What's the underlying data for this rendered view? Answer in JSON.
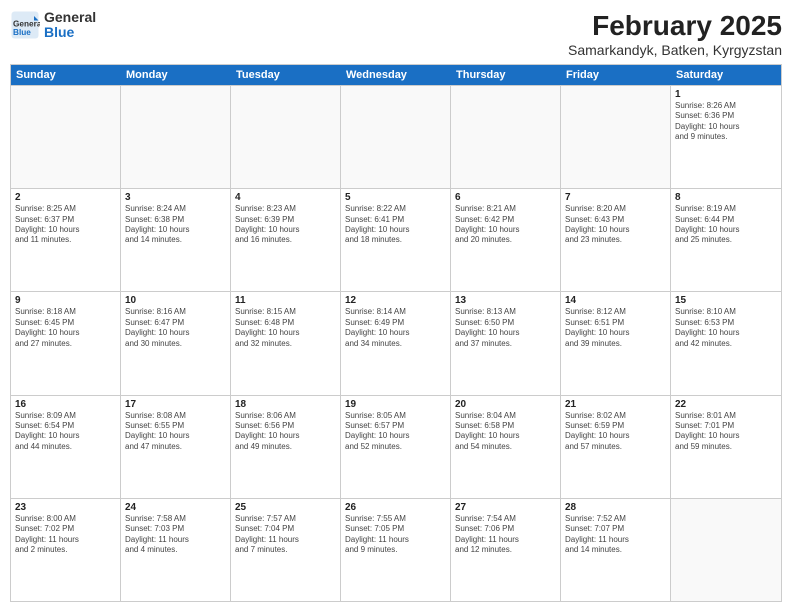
{
  "logo": {
    "general": "General",
    "blue": "Blue"
  },
  "title": "February 2025",
  "location": "Samarkandyk, Batken, Kyrgyzstan",
  "header_days": [
    "Sunday",
    "Monday",
    "Tuesday",
    "Wednesday",
    "Thursday",
    "Friday",
    "Saturday"
  ],
  "weeks": [
    [
      {
        "day": "",
        "info": ""
      },
      {
        "day": "",
        "info": ""
      },
      {
        "day": "",
        "info": ""
      },
      {
        "day": "",
        "info": ""
      },
      {
        "day": "",
        "info": ""
      },
      {
        "day": "",
        "info": ""
      },
      {
        "day": "1",
        "info": "Sunrise: 8:26 AM\nSunset: 6:36 PM\nDaylight: 10 hours\nand 9 minutes."
      }
    ],
    [
      {
        "day": "2",
        "info": "Sunrise: 8:25 AM\nSunset: 6:37 PM\nDaylight: 10 hours\nand 11 minutes."
      },
      {
        "day": "3",
        "info": "Sunrise: 8:24 AM\nSunset: 6:38 PM\nDaylight: 10 hours\nand 14 minutes."
      },
      {
        "day": "4",
        "info": "Sunrise: 8:23 AM\nSunset: 6:39 PM\nDaylight: 10 hours\nand 16 minutes."
      },
      {
        "day": "5",
        "info": "Sunrise: 8:22 AM\nSunset: 6:41 PM\nDaylight: 10 hours\nand 18 minutes."
      },
      {
        "day": "6",
        "info": "Sunrise: 8:21 AM\nSunset: 6:42 PM\nDaylight: 10 hours\nand 20 minutes."
      },
      {
        "day": "7",
        "info": "Sunrise: 8:20 AM\nSunset: 6:43 PM\nDaylight: 10 hours\nand 23 minutes."
      },
      {
        "day": "8",
        "info": "Sunrise: 8:19 AM\nSunset: 6:44 PM\nDaylight: 10 hours\nand 25 minutes."
      }
    ],
    [
      {
        "day": "9",
        "info": "Sunrise: 8:18 AM\nSunset: 6:45 PM\nDaylight: 10 hours\nand 27 minutes."
      },
      {
        "day": "10",
        "info": "Sunrise: 8:16 AM\nSunset: 6:47 PM\nDaylight: 10 hours\nand 30 minutes."
      },
      {
        "day": "11",
        "info": "Sunrise: 8:15 AM\nSunset: 6:48 PM\nDaylight: 10 hours\nand 32 minutes."
      },
      {
        "day": "12",
        "info": "Sunrise: 8:14 AM\nSunset: 6:49 PM\nDaylight: 10 hours\nand 34 minutes."
      },
      {
        "day": "13",
        "info": "Sunrise: 8:13 AM\nSunset: 6:50 PM\nDaylight: 10 hours\nand 37 minutes."
      },
      {
        "day": "14",
        "info": "Sunrise: 8:12 AM\nSunset: 6:51 PM\nDaylight: 10 hours\nand 39 minutes."
      },
      {
        "day": "15",
        "info": "Sunrise: 8:10 AM\nSunset: 6:53 PM\nDaylight: 10 hours\nand 42 minutes."
      }
    ],
    [
      {
        "day": "16",
        "info": "Sunrise: 8:09 AM\nSunset: 6:54 PM\nDaylight: 10 hours\nand 44 minutes."
      },
      {
        "day": "17",
        "info": "Sunrise: 8:08 AM\nSunset: 6:55 PM\nDaylight: 10 hours\nand 47 minutes."
      },
      {
        "day": "18",
        "info": "Sunrise: 8:06 AM\nSunset: 6:56 PM\nDaylight: 10 hours\nand 49 minutes."
      },
      {
        "day": "19",
        "info": "Sunrise: 8:05 AM\nSunset: 6:57 PM\nDaylight: 10 hours\nand 52 minutes."
      },
      {
        "day": "20",
        "info": "Sunrise: 8:04 AM\nSunset: 6:58 PM\nDaylight: 10 hours\nand 54 minutes."
      },
      {
        "day": "21",
        "info": "Sunrise: 8:02 AM\nSunset: 6:59 PM\nDaylight: 10 hours\nand 57 minutes."
      },
      {
        "day": "22",
        "info": "Sunrise: 8:01 AM\nSunset: 7:01 PM\nDaylight: 10 hours\nand 59 minutes."
      }
    ],
    [
      {
        "day": "23",
        "info": "Sunrise: 8:00 AM\nSunset: 7:02 PM\nDaylight: 11 hours\nand 2 minutes."
      },
      {
        "day": "24",
        "info": "Sunrise: 7:58 AM\nSunset: 7:03 PM\nDaylight: 11 hours\nand 4 minutes."
      },
      {
        "day": "25",
        "info": "Sunrise: 7:57 AM\nSunset: 7:04 PM\nDaylight: 11 hours\nand 7 minutes."
      },
      {
        "day": "26",
        "info": "Sunrise: 7:55 AM\nSunset: 7:05 PM\nDaylight: 11 hours\nand 9 minutes."
      },
      {
        "day": "27",
        "info": "Sunrise: 7:54 AM\nSunset: 7:06 PM\nDaylight: 11 hours\nand 12 minutes."
      },
      {
        "day": "28",
        "info": "Sunrise: 7:52 AM\nSunset: 7:07 PM\nDaylight: 11 hours\nand 14 minutes."
      },
      {
        "day": "",
        "info": ""
      }
    ]
  ]
}
